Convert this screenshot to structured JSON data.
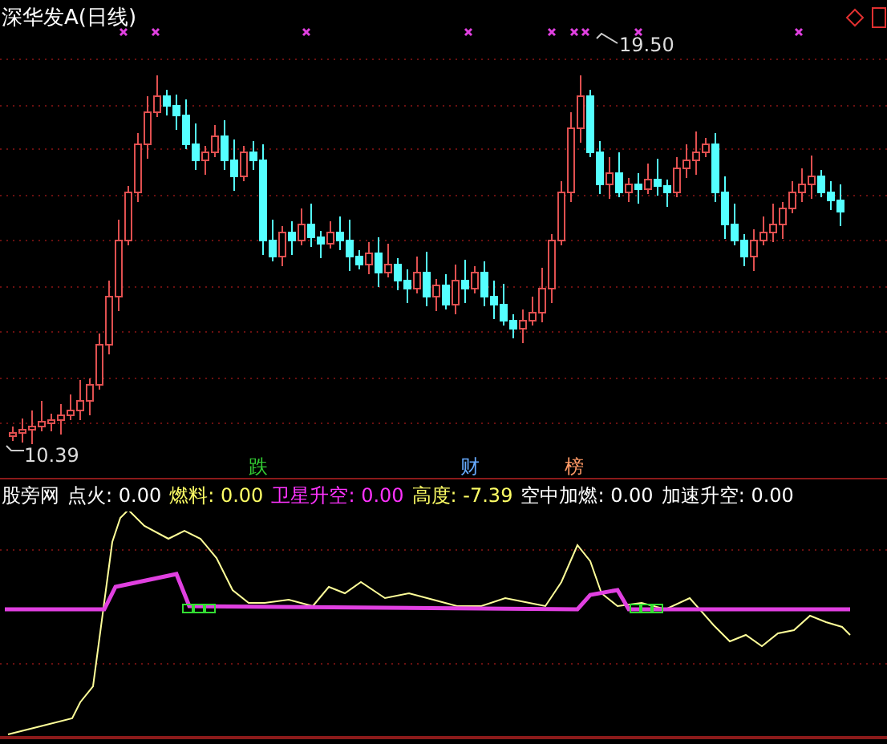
{
  "title": "深华发A(日线)",
  "price_labels": [
    {
      "kind": "high",
      "text": "19.50"
    },
    {
      "kind": "low",
      "text": "10.39"
    }
  ],
  "event_tags": [
    {
      "text": "跌",
      "color": "#33cc33"
    },
    {
      "text": "财",
      "color": "#66aaff"
    },
    {
      "text": "榜",
      "color": "#ff9966"
    }
  ],
  "indicator": {
    "name": "股旁网",
    "values": [
      {
        "label": "点火:",
        "value": "0.00",
        "color": "#ffffff"
      },
      {
        "label": "燃料:",
        "value": "0.00",
        "color": "#ffff66"
      },
      {
        "label": "卫星升空:",
        "value": "0.00",
        "color": "#ff33ff"
      },
      {
        "label": "高度:",
        "value": "-7.39",
        "color": "#ffff66"
      },
      {
        "label": "空中加燃:",
        "value": "0.00",
        "color": "#ffffff"
      },
      {
        "label": "加速升空:",
        "value": "0.00",
        "color": "#ffffff"
      }
    ]
  }
}
